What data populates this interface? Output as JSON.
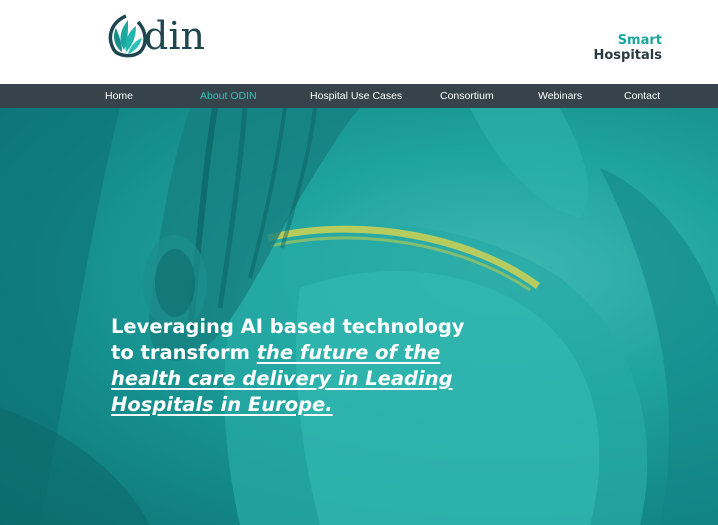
{
  "brand": {
    "logo_text": "din",
    "logo_icon": "odin-leaf-icon",
    "colors": {
      "primary_teal": "#1aa7a0",
      "dark": "#2b3a40",
      "nav_bg": "#36434a",
      "nav_active": "#2ec4bb"
    }
  },
  "tagline": {
    "line1": "Smart",
    "line2": "Hospitals"
  },
  "nav": {
    "items": [
      {
        "label": "Home",
        "active": false
      },
      {
        "label": "About ODIN",
        "active": true
      },
      {
        "label": "Hospital Use Cases",
        "active": false
      },
      {
        "label": "Consortium",
        "active": false
      },
      {
        "label": "Webinars",
        "active": false
      },
      {
        "label": "Contact",
        "active": false
      }
    ]
  },
  "hero": {
    "headline_plain": "Leveraging AI based technology to transform ",
    "headline_emphasis": "the future of the health care delivery in Leading Hospitals in Europe."
  }
}
